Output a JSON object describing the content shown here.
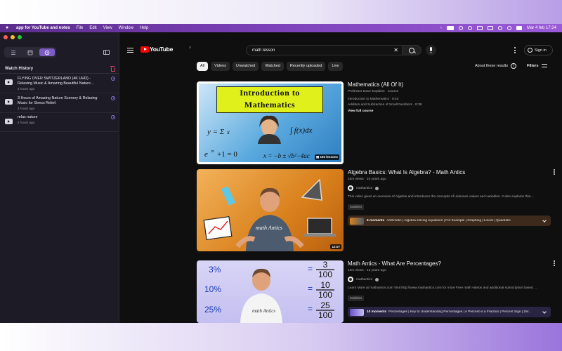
{
  "menubar": {
    "app_name": "app for YouTube and notes",
    "items": [
      "File",
      "Edit",
      "View",
      "Window",
      "Help"
    ],
    "datetime": "Mar 4 feb  17:24"
  },
  "sidebar": {
    "section_title": "Watch History",
    "history": [
      {
        "title": "FLYING OVER SWITZERLAND (4K UHD) - Relaxing Music & Amazing Beautiful Nature...",
        "time": "4 hours ago"
      },
      {
        "title": "3 Hours of Amazing Nature Scenery & Relaxing Music for Stress Relief.",
        "time": "4 hours ago"
      },
      {
        "title": "relax nature",
        "time": "4 hours ago"
      }
    ]
  },
  "header": {
    "logo_text": "YouTube",
    "region": "IT",
    "search_query": "math lesson",
    "clear_symbol": "✕",
    "sign_in": "Sign in"
  },
  "chips": [
    "All",
    "Videos",
    "Unwatched",
    "Watched",
    "Recently uploaded",
    "Live"
  ],
  "filter_bar": {
    "about": "About these results",
    "filters": "Filters"
  },
  "results": [
    {
      "title": "Mathematics (All Of It)",
      "meta": "Professor Dave Explains · Course",
      "lines": [
        "Introduction to Mathematics · 8:44",
        "Addition and Subtraction of Small Numbers · 8:39"
      ],
      "full_course": "View full course",
      "badge": "193 lessons",
      "thumb_heading_1": "Introduction to",
      "thumb_heading_2": "Mathematics"
    },
    {
      "title": "Algebra Basics: What Is Algebra? - Math Antics",
      "meta": "10m views · 10 years ago",
      "channel": "mathantics",
      "description": "This video gives an overview of Algebra and introduces the concepts of unknown values and variables. It also explains that ...",
      "subtitles": "Subtitles",
      "moments_count": "6 moments",
      "moments_text": "Arithmetic | Algebra solving equations | For Example | Graphing | Linear | Quadratic",
      "duration": "12:07",
      "thumb_shirt": "math Antics"
    },
    {
      "title": "Math Antics - What Are Percentages?",
      "meta": "10m views · 13 years ago",
      "channel": "mathantics",
      "description": "Learn More at mathantics.com Visit http://www.mathantics.com for more Free math videos and additional subscription based ...",
      "subtitles": "Subtitles",
      "moments_count": "10 moments",
      "moments_text": "Percentages | Key to Understanding Percentages | A Percent is a Fraction | Percent Sign | Zer...",
      "thumb_pcts": [
        "3%",
        "10%",
        "25%"
      ],
      "thumb_nums": [
        "3",
        "10",
        "25"
      ],
      "thumb_den": "100"
    }
  ]
}
